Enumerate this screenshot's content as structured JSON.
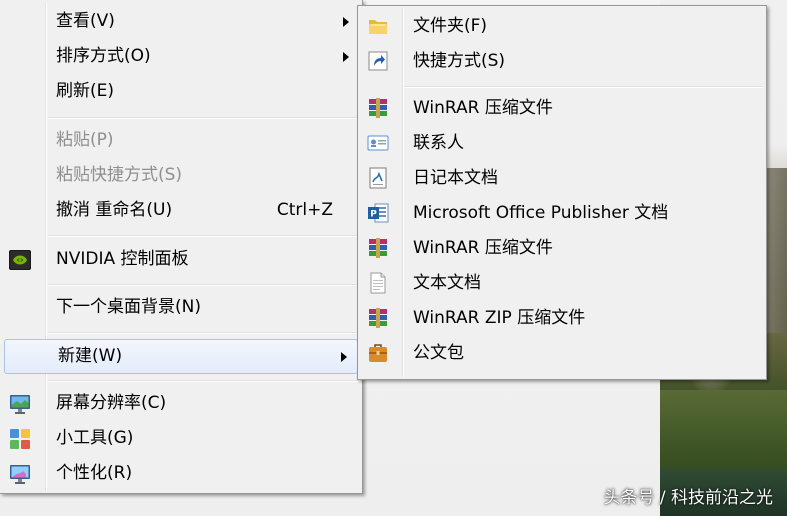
{
  "main_menu": {
    "items": [
      {
        "label": "查看(V)",
        "has_submenu": true,
        "enabled": true
      },
      {
        "label": "排序方式(O)",
        "has_submenu": true,
        "enabled": true
      },
      {
        "label": "刷新(E)",
        "enabled": true
      },
      {
        "label": "粘贴(P)",
        "enabled": false
      },
      {
        "label": "粘贴快捷方式(S)",
        "enabled": false
      },
      {
        "label": "撤消 重命名(U)",
        "shortcut": "Ctrl+Z",
        "enabled": true
      },
      {
        "label": "NVIDIA 控制面板",
        "icon": "nvidia-icon",
        "enabled": true
      },
      {
        "label": "下一个桌面背景(N)",
        "enabled": true
      },
      {
        "label": "新建(W)",
        "has_submenu": true,
        "highlighted": true,
        "enabled": true
      },
      {
        "label": "屏幕分辨率(C)",
        "icon": "display-icon",
        "enabled": true
      },
      {
        "label": "小工具(G)",
        "icon": "gadgets-icon",
        "enabled": true
      },
      {
        "label": "个性化(R)",
        "icon": "personalize-icon",
        "enabled": true
      }
    ]
  },
  "new_submenu": {
    "items": [
      {
        "label": "文件夹(F)",
        "icon": "folder-icon"
      },
      {
        "label": "快捷方式(S)",
        "icon": "shortcut-icon"
      },
      {
        "label": "WinRAR 压缩文件",
        "icon": "winrar-icon"
      },
      {
        "label": "联系人",
        "icon": "contact-icon"
      },
      {
        "label": "日记本文档",
        "icon": "journal-icon"
      },
      {
        "label": "Microsoft Office Publisher 文档",
        "icon": "publisher-icon"
      },
      {
        "label": "WinRAR 压缩文件",
        "icon": "winrar-icon"
      },
      {
        "label": "文本文档",
        "icon": "text-document-icon"
      },
      {
        "label": "WinRAR ZIP 压缩文件",
        "icon": "winrar-zip-icon"
      },
      {
        "label": "公文包",
        "icon": "briefcase-icon"
      }
    ]
  },
  "watermark": "头条号 / 科技前沿之光",
  "colors": {
    "menu_bg": "#f0f0f0",
    "highlight_border": "#a8c3ec",
    "disabled_text": "#8f8f8f",
    "nvidia_green": "#76b900"
  }
}
